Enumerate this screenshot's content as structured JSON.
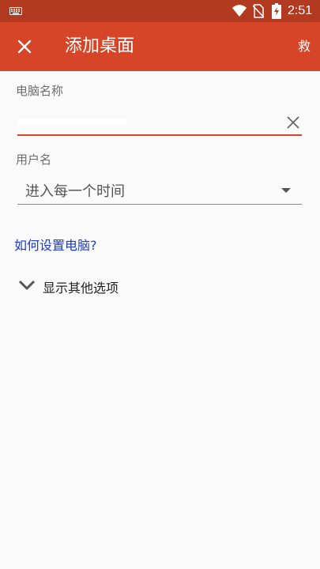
{
  "status_bar": {
    "time": "2:51",
    "icons": [
      "keyboard-icon",
      "wifi-icon",
      "no-sim-icon",
      "battery-charging-icon"
    ]
  },
  "app_bar": {
    "title": "添加桌面",
    "action_label": "救",
    "close_icon": "close-icon",
    "background": "#D64527"
  },
  "form": {
    "pc_name": {
      "label": "电脑名称",
      "value": "",
      "clear_icon": "clear-icon"
    },
    "user_name": {
      "label": "用户名",
      "placeholder": "进入每一个时间"
    },
    "help_link": "如何设置电脑?",
    "more_options": "显示其他选项"
  },
  "colors": {
    "status_bar": "#B23A20",
    "accent": "#D64527",
    "link": "#1E3CC8",
    "background": "#FAFAFA"
  }
}
